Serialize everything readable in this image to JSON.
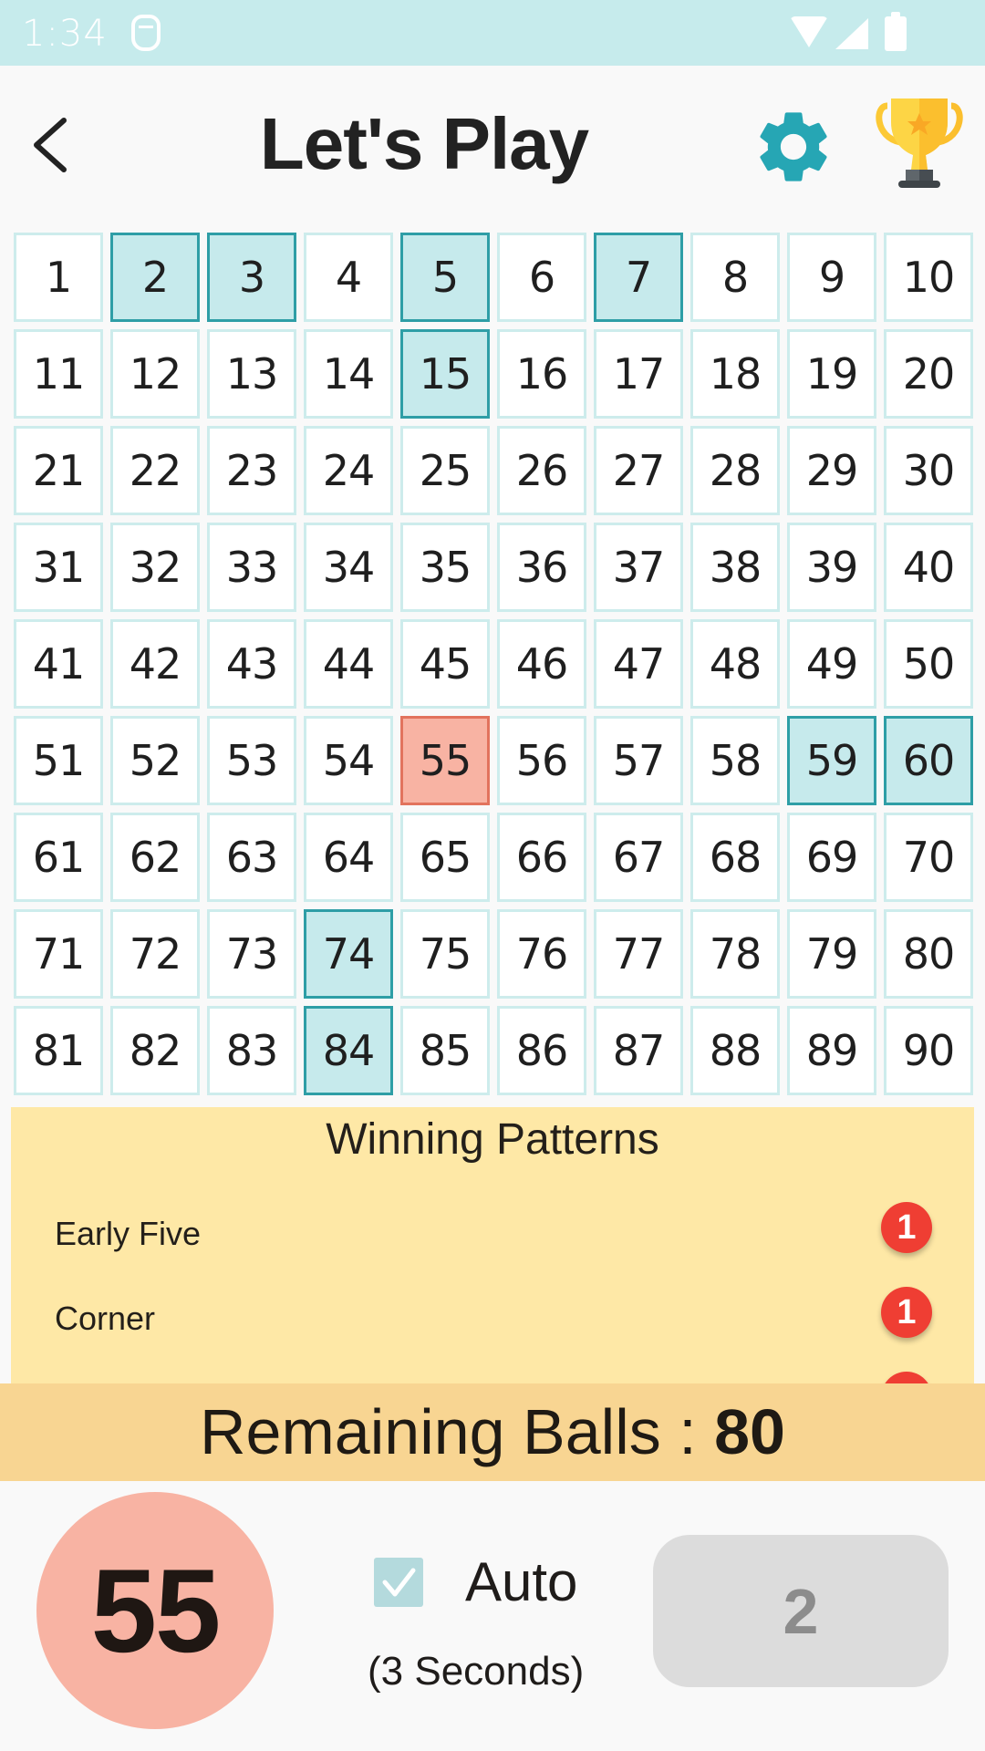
{
  "status_bar": {
    "time": "1:34",
    "icons": [
      "app-notification-icon",
      "wifi-icon",
      "cell-signal-icon",
      "battery-icon"
    ]
  },
  "header": {
    "title": "Let's Play",
    "back_icon": "chevron-left-icon",
    "settings_icon": "gear-icon",
    "leaderboard_icon": "trophy-icon"
  },
  "board": {
    "numbers": [
      1,
      2,
      3,
      4,
      5,
      6,
      7,
      8,
      9,
      10,
      11,
      12,
      13,
      14,
      15,
      16,
      17,
      18,
      19,
      20,
      21,
      22,
      23,
      24,
      25,
      26,
      27,
      28,
      29,
      30,
      31,
      32,
      33,
      34,
      35,
      36,
      37,
      38,
      39,
      40,
      41,
      42,
      43,
      44,
      45,
      46,
      47,
      48,
      49,
      50,
      51,
      52,
      53,
      54,
      55,
      56,
      57,
      58,
      59,
      60,
      61,
      62,
      63,
      64,
      65,
      66,
      67,
      68,
      69,
      70,
      71,
      72,
      73,
      74,
      75,
      76,
      77,
      78,
      79,
      80,
      81,
      82,
      83,
      84,
      85,
      86,
      87,
      88,
      89,
      90
    ],
    "called": [
      2,
      3,
      5,
      7,
      15,
      59,
      60,
      74,
      84
    ],
    "current": 55
  },
  "winning_patterns": {
    "title": "Winning Patterns",
    "items": [
      {
        "name": "Early Five",
        "count": "1"
      },
      {
        "name": "Corner",
        "count": "1"
      },
      {
        "name": "",
        "count": ""
      }
    ]
  },
  "remaining": {
    "label": "Remaining Balls : ",
    "value": "80"
  },
  "controls": {
    "current_ball": "55",
    "auto_label": "Auto",
    "auto_checked": true,
    "auto_interval": "(3 Seconds)",
    "next_button_label": "2"
  },
  "colors": {
    "status_bar": "#c6ebec",
    "called_fill": "#c6eaec",
    "called_border": "#2e9ea6",
    "current_fill": "#f8b3a3",
    "patterns_bg": "#fee8a6",
    "remaining_bg": "#f8d592",
    "badge": "#ef3e33",
    "gear": "#26a6b4"
  }
}
